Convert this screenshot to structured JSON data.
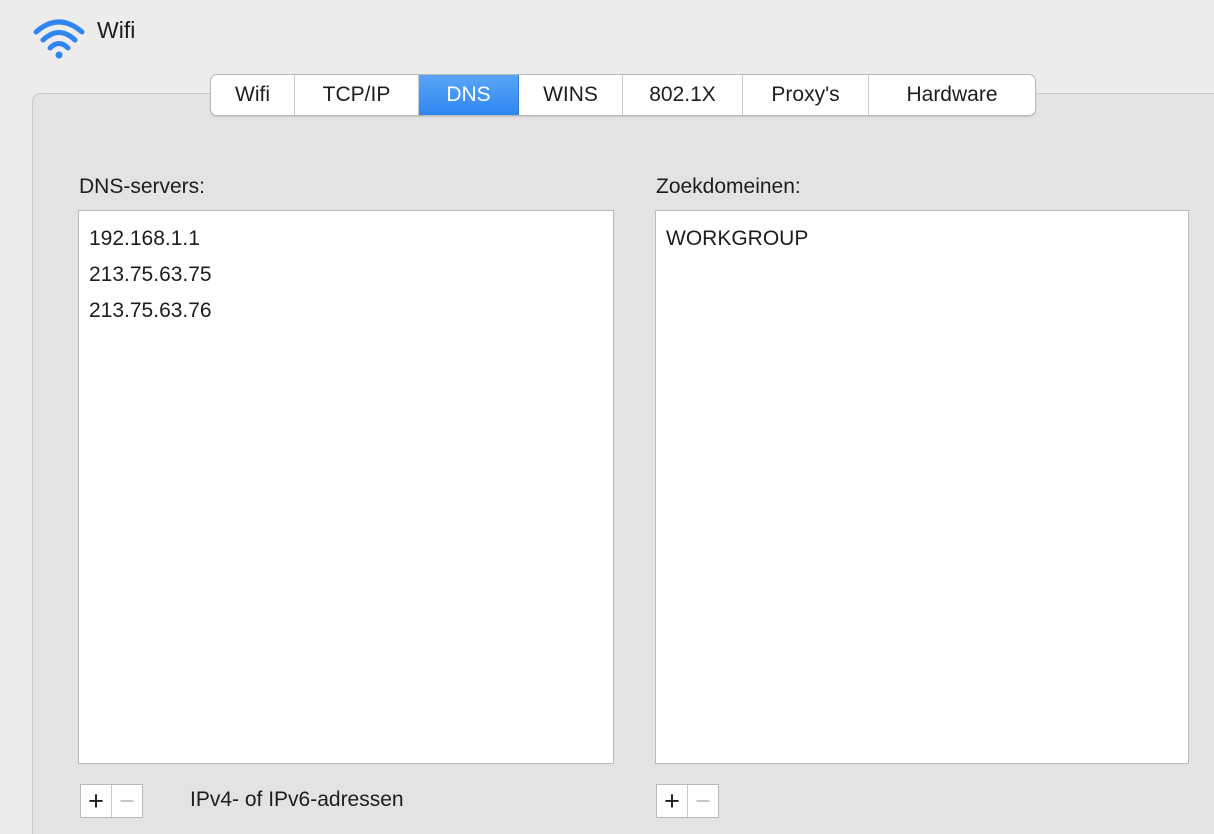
{
  "window": {
    "title": "Wifi",
    "icon": "wifi-icon",
    "accent_color": "#2f86f0"
  },
  "tabs": [
    {
      "label": "Wifi",
      "active": false
    },
    {
      "label": "TCP/IP",
      "active": false
    },
    {
      "label": "DNS",
      "active": true
    },
    {
      "label": "WINS",
      "active": false
    },
    {
      "label": "802.1X",
      "active": false
    },
    {
      "label": "Proxy's",
      "active": false
    },
    {
      "label": "Hardware",
      "active": false
    }
  ],
  "dns_servers": {
    "label": "DNS-servers:",
    "items": [
      "192.168.1.1",
      "213.75.63.75",
      "213.75.63.76"
    ],
    "add_label": "+",
    "remove_label": "−",
    "hint": "IPv4- of IPv6-adressen"
  },
  "search_domains": {
    "label": "Zoekdomeinen:",
    "items": [
      "WORKGROUP"
    ],
    "add_label": "+",
    "remove_label": "−"
  }
}
